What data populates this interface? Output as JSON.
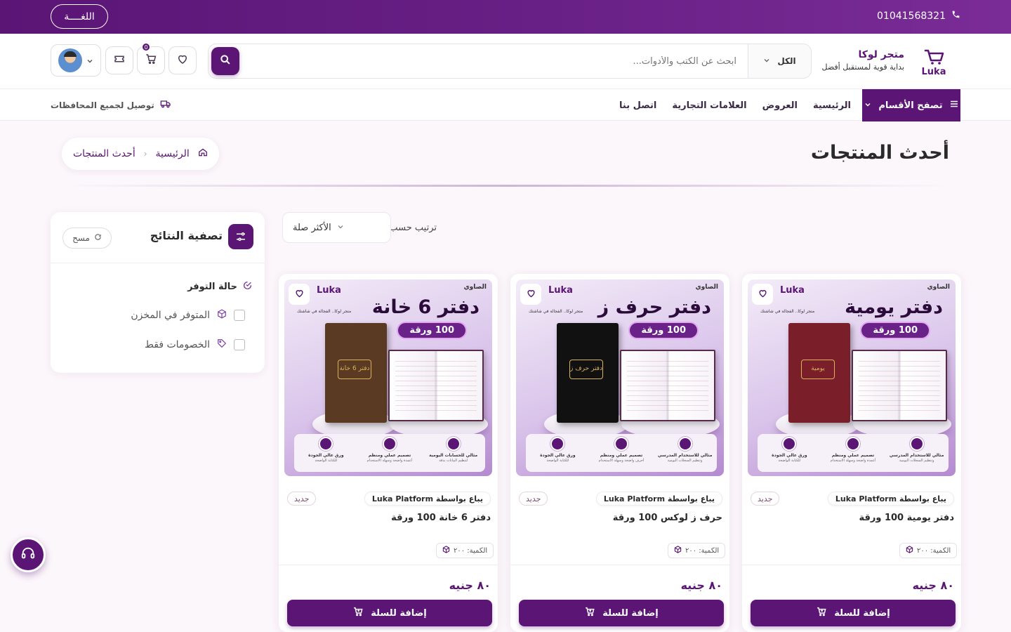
{
  "topbar": {
    "phone": "01041568321",
    "language_label": "اللغــــة"
  },
  "header": {
    "brand_name": "متجر لوكا",
    "brand_tagline": "بداية قوية لمستقبل أفضل",
    "search": {
      "category": "الكل",
      "placeholder": "ابحث عن الكتب والأدوات..."
    },
    "cart_count": "0"
  },
  "nav": {
    "browse_label": "تصفح الأقسام",
    "links": [
      "الرئيسية",
      "العروض",
      "العلامات التجارية",
      "اتصل بنا"
    ],
    "delivery": "توصيل لجميع المحافظات"
  },
  "page": {
    "title": "أحدث المنتجات",
    "breadcrumb": {
      "home": "الرئيسية",
      "current": "أحدث المنتجات"
    }
  },
  "filters": {
    "title": "تصفية النتائج",
    "clear_label": "مسح",
    "availability_title": "حالة التوفر",
    "options": [
      "المتوفر في المخزن",
      "الخصومات فقط"
    ]
  },
  "sort": {
    "label": "ترتيب حسب",
    "selected": "الأكثر صلة"
  },
  "products": [
    {
      "hero_title": "دفتر يومية",
      "pill": "100 ورقة",
      "cover_label": "يومية",
      "cover_color": "#7a1f2a",
      "seller": "يباع بواسطة Luka Platform",
      "badge": "جديد",
      "name": "دفتر يومية 100 ورقة",
      "qty": "الكمية: ٢٠٠",
      "price": "٨٠ جنيه",
      "add_label": "إضافة للسلة",
      "features": [
        {
          "t": "مثالي للاستخدام المدرسي",
          "s": "وتنظيم السجلات اليومية"
        },
        {
          "t": "تصميم عملي ومنظم",
          "s": "أعمدة واضحة وسهلة الاستخدام"
        },
        {
          "t": "ورق عالي الجودة",
          "s": "للكتابة الواضحة"
        }
      ]
    },
    {
      "hero_title": "دفتر حرف ز",
      "pill": "100 ورقة",
      "cover_label": "دفتر حرف ز",
      "cover_color": "#111111",
      "seller": "يباع بواسطة Luka Platform",
      "badge": "جديد",
      "name": "حرف ز لوكس 100 ورقة",
      "qty": "الكمية: ٢٠٠",
      "price": "٨٠ جنيه",
      "add_label": "إضافة للسلة",
      "features": [
        {
          "t": "مثالي للاستخدام المدرسي",
          "s": "وتنظيم السجلات اليومية"
        },
        {
          "t": "تصميم عملي ومنظم",
          "s": "أحرف واضحة وسهلة الاستخدام"
        },
        {
          "t": "ورق عالي الجودة",
          "s": "للكتابة الواضحة"
        }
      ]
    },
    {
      "hero_title": "دفتر 6 خانة",
      "pill": "100 ورقة",
      "cover_label": "دفتر 6 خانة",
      "cover_color": "#5a3a22",
      "seller": "يباع بواسطة Luka Platform",
      "badge": "جديد",
      "name": "دفتر 6 خانة 100 ورقة",
      "qty": "الكمية: ٢٠٠",
      "price": "٨٠ جنيه",
      "add_label": "إضافة للسلة",
      "features": [
        {
          "t": "مثالي للحسابات اليومية",
          "s": "لتنظيم البيانات بدقة"
        },
        {
          "t": "تصميم عملي ومنظم",
          "s": "أعمدة واضحة وسهلة الاستخدام"
        },
        {
          "t": "ورق عالي الجودة",
          "s": "للكتابة الواضحة"
        }
      ]
    }
  ],
  "product_image_text": {
    "mini_logo": "Luka",
    "mini_tag": "متجر لوكا.. الفجالة في شاشتك",
    "brand_mark": "الصاوي"
  },
  "colors": {
    "primary": "#5a1575",
    "accent": "#7b2c97"
  },
  "icons": {
    "phone": "phone-icon",
    "search": "search-icon",
    "cart": "cart-icon",
    "wishlist": "heart-icon",
    "ticket": "ticket-icon",
    "support": "headset-icon"
  }
}
